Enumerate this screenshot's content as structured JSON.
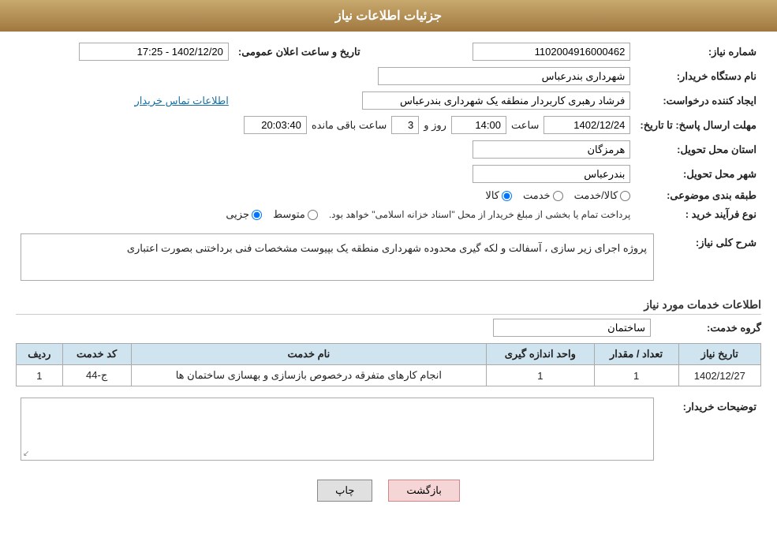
{
  "header": {
    "title": "جزئیات اطلاعات نیاز"
  },
  "fields": {
    "need_number_label": "شماره نیاز:",
    "need_number_value": "1102004916000462",
    "buyer_org_label": "نام دستگاه خریدار:",
    "buyer_org_value": "شهرداری بندرعباس",
    "announcement_label": "تاریخ و ساعت اعلان عمومی:",
    "announcement_value": "1402/12/20 - 17:25",
    "creator_label": "ایجاد کننده درخواست:",
    "creator_value": "فرشاد رهبری کاربردار منطقه یک شهرداری بندرعباس",
    "contact_link": "اطلاعات تماس خریدار",
    "deadline_label": "مهلت ارسال پاسخ: تا تاریخ:",
    "deadline_date": "1402/12/24",
    "deadline_time_label": "ساعت",
    "deadline_time": "14:00",
    "deadline_days_label": "روز و",
    "deadline_days": "3",
    "deadline_remaining_label": "ساعت باقی مانده",
    "deadline_remaining": "20:03:40",
    "province_label": "استان محل تحویل:",
    "province_value": "هرمزگان",
    "city_label": "شهر محل تحویل:",
    "city_value": "بندرعباس",
    "category_label": "طبقه بندی موضوعی:",
    "category_kala": "کالا",
    "category_khadamat": "خدمت",
    "category_kala_khadamat": "کالا/خدمت",
    "purchase_type_label": "نوع فرآیند خرید :",
    "purchase_jozei": "جزیی",
    "purchase_motavasset": "متوسط",
    "purchase_note": "پرداخت تمام یا بخشی از مبلغ خریدار از محل \"اسناد خزانه اسلامی\" خواهد بود.",
    "description_label": "شرح کلی نیاز:",
    "description_value": "پروژه اجرای زیر سازی ، آسفالت و لکه گیری محدوده شهرداری منطقه یک بپیوست مشخصات فنی برداختنی بصورت اعتباری",
    "services_section_label": "اطلاعات خدمات مورد نیاز",
    "group_service_label": "گروه خدمت:",
    "group_service_value": "ساختمان",
    "table_headers": {
      "row": "ردیف",
      "code": "کد خدمت",
      "name": "نام خدمت",
      "unit": "واحد اندازه گیری",
      "count": "تعداد / مقدار",
      "date": "تاریخ نیاز"
    },
    "table_rows": [
      {
        "row": "1",
        "code": "ج-44",
        "name": "انجام کارهای متفرقه درخصوص بازسازی و بهسازی ساختمان ها",
        "unit": "1",
        "count": "1",
        "date": "1402/12/27"
      }
    ],
    "buyer_notes_label": "توضیحات خریدار:",
    "buyer_notes_value": "",
    "btn_back": "بازگشت",
    "btn_print": "چاپ"
  }
}
